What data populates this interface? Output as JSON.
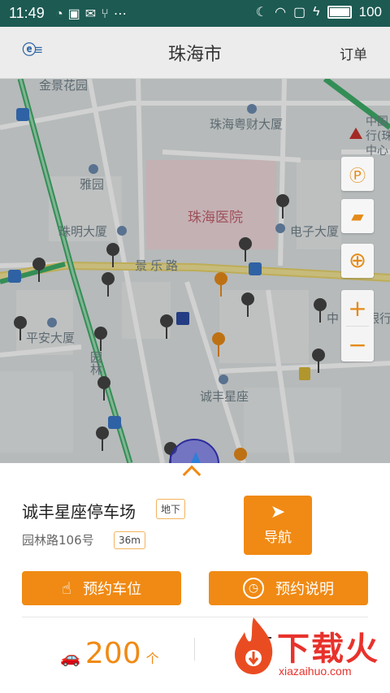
{
  "status_bar": {
    "time": "11:49",
    "left_icons": [
      "weather-icon",
      "image-icon",
      "mail-icon",
      "share-icon",
      "more-icon"
    ],
    "battery_level": "100"
  },
  "header": {
    "city": "珠海市",
    "orders_label": "订单"
  },
  "map": {
    "labels": {
      "jinjinghuayuan": "金景花园",
      "yuecaidasha": "珠海粤财大厦",
      "zhongguo": "中国",
      "hang": "行(珠",
      "zhongxin": "中心",
      "yayuan": "雅园",
      "hospital": "珠海医院",
      "zhuming": "珠明大厦",
      "dianzi": "电子大厦",
      "jingle": "景乐路",
      "zhong": "中",
      "yinhang": "银行",
      "pingan": "平安大厦",
      "yuanlin": "园林",
      "chengfeng": "诚丰星座"
    },
    "controls": [
      "parking-icon",
      "road-icon",
      "locate-icon"
    ],
    "zoom_in": "+",
    "zoom_out": "−"
  },
  "panel": {
    "parking_name": "诚丰星座停车场",
    "type_tag": "地下",
    "address": "园林路106号",
    "distance": "36m",
    "navigate_label": "导航",
    "reserve_label": "预约车位",
    "reserve_info_label": "预约说明",
    "spaces_count": "200",
    "spaces_unit": "个",
    "second_value": "-"
  },
  "watermark": {
    "title": "下载火",
    "url": "xiazaihuo.com"
  },
  "colors": {
    "accent": "#f08a14",
    "status_bar": "#1c5a52",
    "watermark": "#e8322c"
  }
}
